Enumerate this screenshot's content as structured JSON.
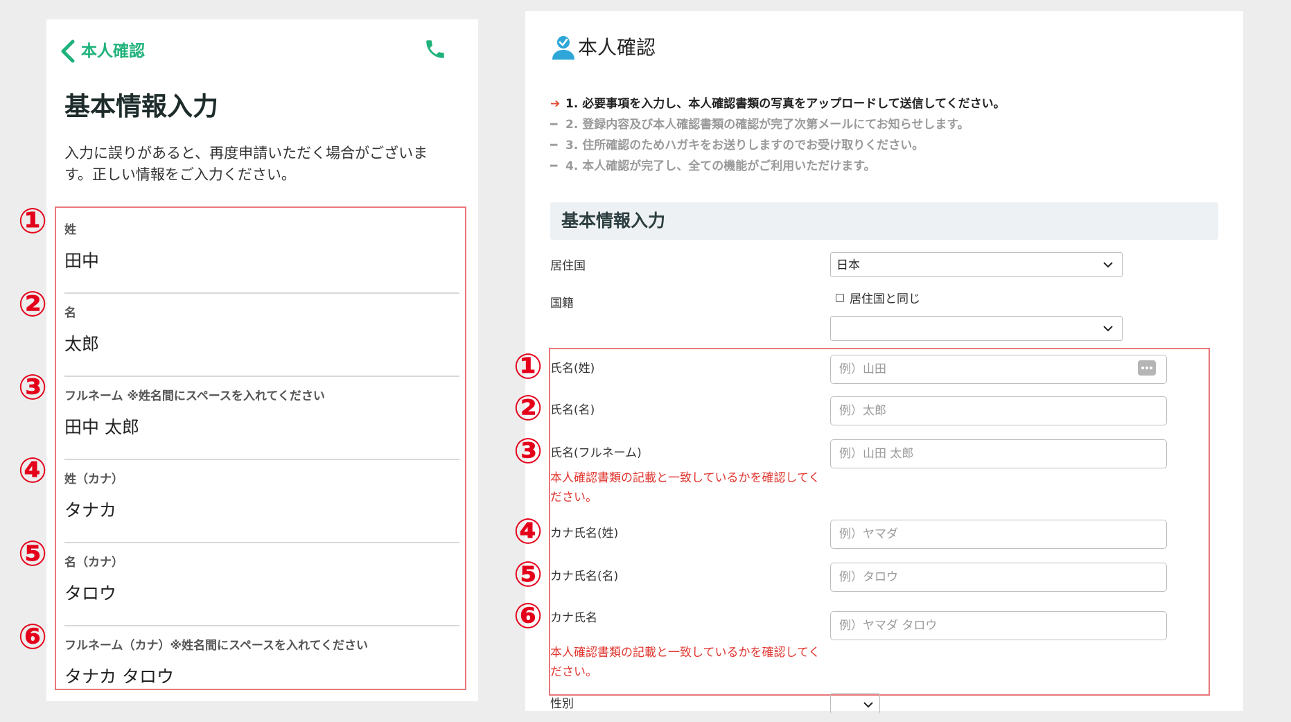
{
  "mobile": {
    "header_title": "本人確認",
    "page_title": "基本情報入力",
    "description": "入力に誤りがあると、再度申請いただく場合がございます。正しい情報をご入力ください。",
    "fields": [
      {
        "num": "①",
        "label": "姓",
        "value": "田中"
      },
      {
        "num": "②",
        "label": "名",
        "value": "太郎"
      },
      {
        "num": "③",
        "label": "フルネーム ※姓名間にスペースを入れてください",
        "value": "田中 太郎"
      },
      {
        "num": "④",
        "label": "姓（カナ）",
        "value": "タナカ"
      },
      {
        "num": "⑤",
        "label": "名（カナ）",
        "value": "タロウ"
      },
      {
        "num": "⑥",
        "label": "フルネーム（カナ）※姓名間にスペースを入れてください",
        "value": "タナカ タロウ"
      }
    ]
  },
  "desktop": {
    "title": "本人確認",
    "steps": [
      {
        "marker": "➔",
        "text": "1. 必要事項を入力し、本人確認書類の写真をアップロードして送信してください。"
      },
      {
        "marker": "━",
        "text": "2. 登録内容及び本人確認書類の確認が完了次第メールにてお知らせします。"
      },
      {
        "marker": "━",
        "text": "3. 住所確認のためハガキをお送りしますのでお受け取りください。"
      },
      {
        "marker": "━",
        "text": "4. 本人確認が完了し、全ての機能がご利用いただけます。"
      }
    ],
    "section_title": "基本情報入力",
    "residence_label": "居住国",
    "residence_value": "日本",
    "nationality_label": "国籍",
    "same_as_residence": "居住国と同じ",
    "nationality_value": "",
    "fields": [
      {
        "num": "①",
        "label": "氏名(姓)",
        "placeholder": "例）山田"
      },
      {
        "num": "②",
        "label": "氏名(名)",
        "placeholder": "例）太郎"
      },
      {
        "num": "③",
        "label": "氏名(フルネーム)",
        "placeholder": "例）山田 太郎"
      },
      {
        "num": "④",
        "label": "カナ氏名(姓)",
        "placeholder": "例）ヤマダ"
      },
      {
        "num": "⑤",
        "label": "カナ氏名(名)",
        "placeholder": "例）タロウ"
      },
      {
        "num": "⑥",
        "label": "カナ氏名",
        "placeholder": "例）ヤマダ タロウ"
      }
    ],
    "note": "本人確認書類の記載と一致しているかを確認してください。",
    "gender_label": "性別"
  },
  "colors": {
    "accent_green": "#1fb27b",
    "highlight_red": "#e4001a",
    "box_border": "#e8777a",
    "note_red": "#e0352f"
  },
  "icons": [
    "chevron-left-icon",
    "phone-icon",
    "user-check-icon",
    "chevron-down-icon",
    "more-dots-icon"
  ]
}
